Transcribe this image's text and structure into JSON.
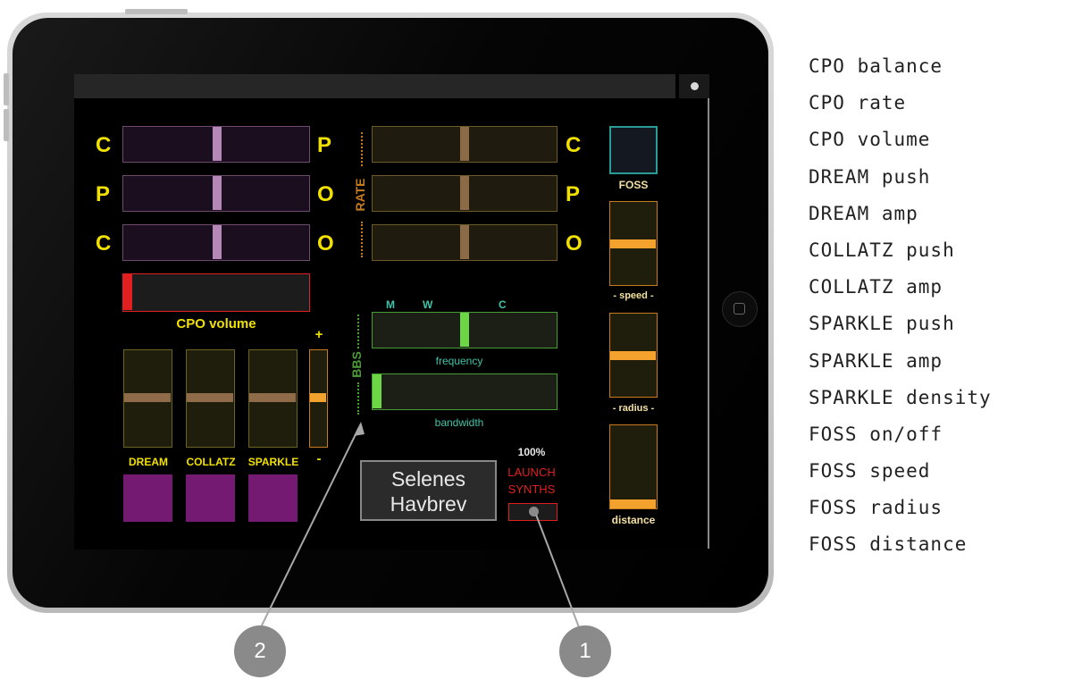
{
  "cpo_rows": [
    {
      "left": "C",
      "right": "P"
    },
    {
      "left": "P",
      "right": "O"
    },
    {
      "left": "C",
      "right": "O"
    }
  ],
  "rate": {
    "label": "RATE",
    "right_letters": [
      "C",
      "P",
      "O"
    ]
  },
  "cpo_volume": {
    "label": "CPO volume"
  },
  "synth_labels": [
    "DREAM",
    "COLLATZ",
    "SPARKLE"
  ],
  "small_slider": {
    "plus": "+",
    "minus": "-"
  },
  "bbs": {
    "label": "BBS",
    "markers": [
      "M",
      "W",
      "C"
    ],
    "frequency_label": "frequency",
    "bandwidth_label": "bandwidth"
  },
  "foss": {
    "label": "FOSS",
    "speed_label": "- speed -",
    "radius_label": "- radius -",
    "distance_label": "distance"
  },
  "title_button": {
    "line1": "Selenes",
    "line2": "Havbrev"
  },
  "launch": {
    "percent": "100%",
    "line1": "LAUNCH",
    "line2": "SYNTHS"
  },
  "callouts": {
    "one": "1",
    "two": "2"
  },
  "legend": [
    "CPO balance",
    "CPO rate",
    "CPO volume",
    "DREAM push",
    "DREAM amp",
    "COLLATZ push",
    "COLLATZ amp",
    "SPARKLE push",
    "SPARKLE amp",
    "SPARKLE density",
    "FOSS on/off",
    "FOSS speed",
    "FOSS radius",
    "FOSS distance"
  ],
  "colors": {
    "yellow": "#f2e000",
    "orange": "#f2a22d",
    "green": "#6cd644",
    "purple": "#751a73",
    "red": "#e02020"
  }
}
